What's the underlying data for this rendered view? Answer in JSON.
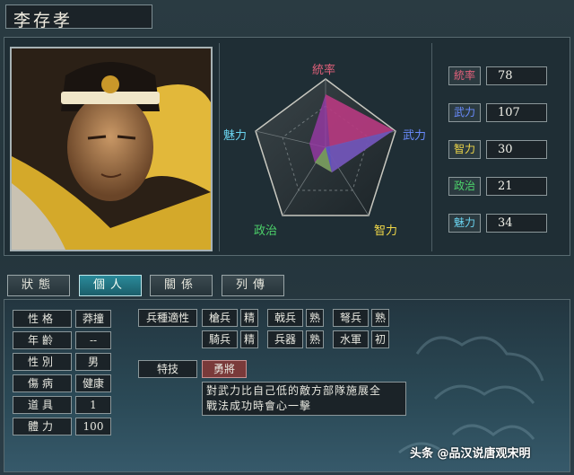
{
  "character": {
    "name": "李存孝"
  },
  "radar": {
    "labels": {
      "top": "統率",
      "right": "武力",
      "bottom_right": "智力",
      "bottom_left": "政治",
      "left": "魅力"
    },
    "label_colors": {
      "top": "#e0607a",
      "right": "#6a8cff",
      "bottom_right": "#f0d848",
      "bottom_left": "#4cd26a",
      "left": "#6ad4f0"
    }
  },
  "stats": [
    {
      "label": "統率",
      "value": "78",
      "color": "#e0607a"
    },
    {
      "label": "武力",
      "value": "107",
      "color": "#6a8cff"
    },
    {
      "label": "智力",
      "value": "30",
      "color": "#f0d848"
    },
    {
      "label": "政治",
      "value": "21",
      "color": "#4cd26a"
    },
    {
      "label": "魅力",
      "value": "34",
      "color": "#6ad4f0"
    }
  ],
  "tabs": [
    {
      "label": "狀態"
    },
    {
      "label": "個人",
      "active": true
    },
    {
      "label": "關係"
    },
    {
      "label": "列傳"
    }
  ],
  "info": [
    {
      "label": "性格",
      "value": "莽撞"
    },
    {
      "label": "年齡",
      "value": "--"
    },
    {
      "label": "性別",
      "value": "男"
    },
    {
      "label": "傷病",
      "value": "健康"
    },
    {
      "label": "道具",
      "value": "1"
    },
    {
      "label": "體力",
      "value": "100"
    }
  ],
  "aptitude": {
    "label": "兵種適性",
    "items": [
      {
        "name": "槍兵",
        "grade": "精"
      },
      {
        "name": "戟兵",
        "grade": "熟"
      },
      {
        "name": "弩兵",
        "grade": "熟"
      },
      {
        "name": "騎兵",
        "grade": "精"
      },
      {
        "name": "兵器",
        "grade": "熟"
      },
      {
        "name": "水軍",
        "grade": "初"
      }
    ]
  },
  "skill": {
    "label": "特技",
    "name": "勇將",
    "desc_line1": "對武力比自己低的敵方部隊施展全",
    "desc_line2": "戰法成功時會心一擊"
  },
  "watermark": "头条 @品汉说唐观宋明"
}
